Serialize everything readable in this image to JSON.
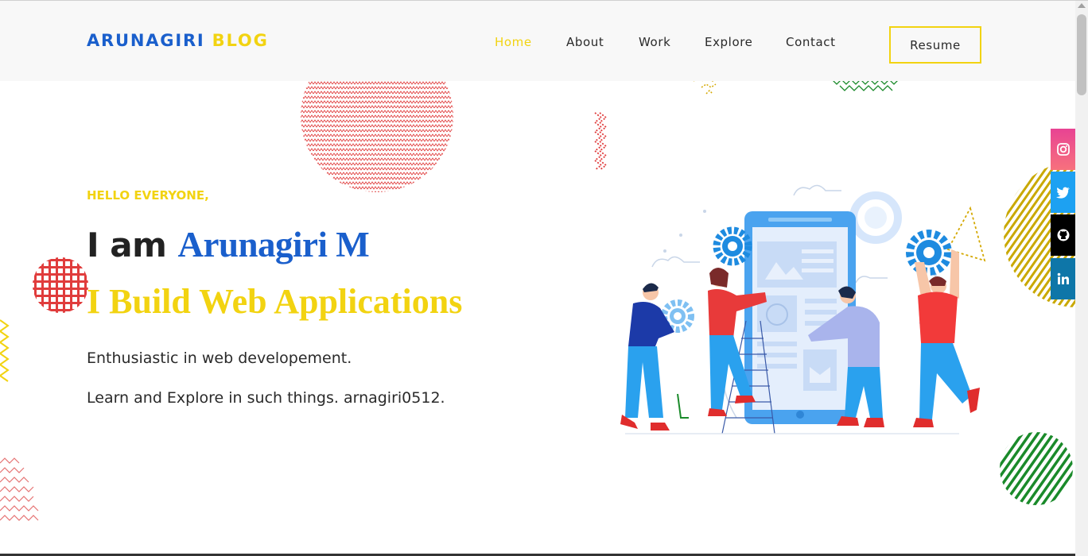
{
  "brand": {
    "part1": "ARUNAGIRI",
    "part2": "BLOG"
  },
  "nav": {
    "items": [
      "Home",
      "About",
      "Work",
      "Explore",
      "Contact"
    ],
    "active": "Home"
  },
  "resume_label": "Resume",
  "hero": {
    "greeting": "HELLO EVERYONE,",
    "iam": "I am",
    "name": "Arunagiri M",
    "tagline": "I Build Web Applications",
    "line1": "Enthusiastic in web developement.",
    "line2": "Learn and Explore in such things. arnagiri0512."
  },
  "social": [
    "instagram-icon",
    "twitter-icon",
    "github-icon",
    "linkedin-icon"
  ],
  "colors": {
    "blue": "#1a5fcc",
    "yellow": "#f2d311",
    "red": "#e03c3c",
    "green": "#1a8a2a",
    "instagram": "#e1306c",
    "twitter": "#1da1f2",
    "github": "#000000",
    "linkedin": "#0e76a8"
  }
}
